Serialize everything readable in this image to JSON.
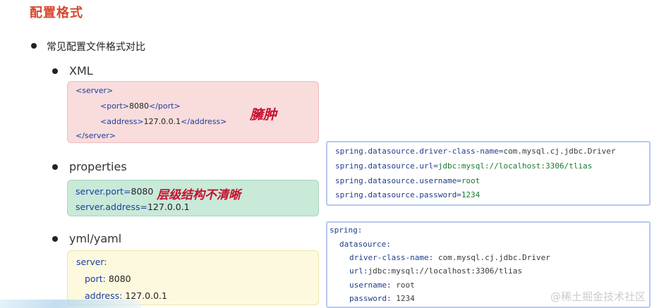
{
  "title": "配置格式",
  "bullet_main": "常见配置文件格式对比",
  "xml": {
    "label": "XML",
    "lines": {
      "l1": "<server>",
      "l2_tag_open": "<port>",
      "l2_val": "8080",
      "l2_tag_close": "</port>",
      "l3_tag_open": "<address>",
      "l3_val": "127.0.0.1",
      "l3_tag_close": "</address>",
      "l4": "</server>"
    },
    "note": "臃肿"
  },
  "properties": {
    "label": "properties",
    "lines": {
      "l1_key": "server.port=",
      "l1_val": "8080",
      "l2_key": "server.address=",
      "l2_val": "127.0.0.1"
    },
    "note": "层级结构不清晰"
  },
  "yml": {
    "label": "yml/yaml",
    "lines": {
      "l1": "server:",
      "l2_key": "port:",
      "l2_val": "8080",
      "l3_key": "address:",
      "l3_val": "127.0.0.1"
    }
  },
  "properties_code": {
    "l1_key": "spring.datasource.driver-class-name=",
    "l1_val": "com.mysql.cj.jdbc.Driver",
    "l2_key": "spring.datasource.url=",
    "l2_val": "jdbc:mysql://localhost:3306/tlias",
    "l3_key": "spring.datasource.username=",
    "l3_val": "root",
    "l4_key": "spring.datasource.password=",
    "l4_val": "1234"
  },
  "yml_code": {
    "l1": "spring:",
    "l2": "datasource:",
    "l3_key": "driver-class-name:",
    "l3_val": "com.mysql.cj.jdbc.Driver",
    "l4_key": "url:",
    "l4_val": "jdbc:mysql://localhost:3306/tlias",
    "l5_key": "username:",
    "l5_val": "root",
    "l6_key": "password:",
    "l6_val": "1234"
  },
  "watermark": "@稀土掘金技术社区"
}
